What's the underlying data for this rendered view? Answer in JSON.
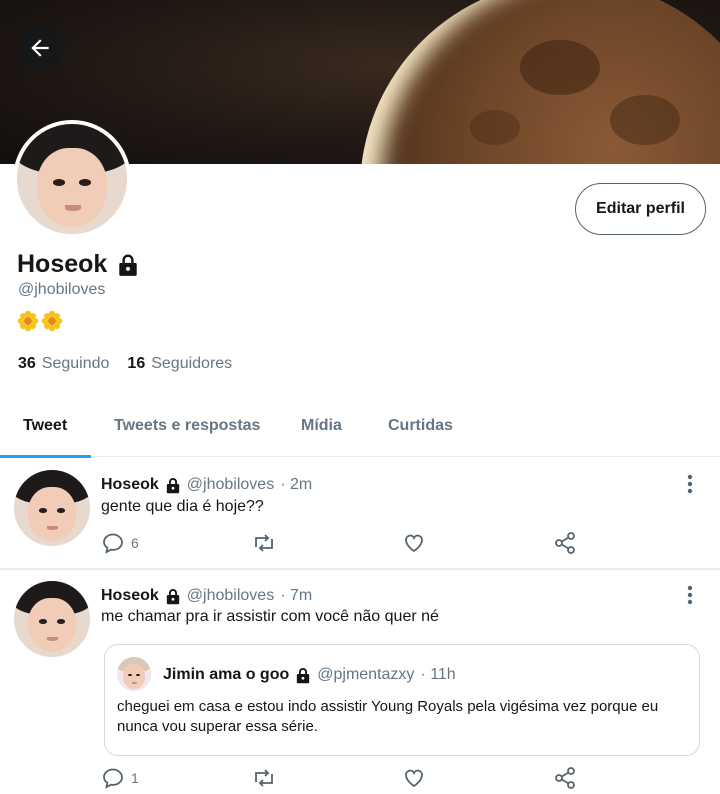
{
  "profile": {
    "display_name": "Hoseok",
    "handle": "@jhobiloves",
    "bio_emoji": [
      "sunflower-emoji",
      "sunflower-emoji"
    ],
    "following_count": "36",
    "following_label": "Seguindo",
    "followers_count": "16",
    "followers_label": "Seguidores",
    "edit_button": "Editar perfil"
  },
  "tabs": [
    {
      "label": "Tweet",
      "active": true
    },
    {
      "label": "Tweets e respostas",
      "active": false
    },
    {
      "label": "Mídia",
      "active": false
    },
    {
      "label": "Curtidas",
      "active": false
    }
  ],
  "tweets": [
    {
      "name": "Hoseok",
      "handle": "@jhobiloves",
      "time": "· 2m",
      "text": "gente que dia é hoje??",
      "reply_count": "6"
    },
    {
      "name": "Hoseok",
      "handle": "@jhobiloves",
      "time": "· 7m",
      "text": "me chamar pra ir assistir com você não quer né",
      "reply_count": "1",
      "quote": {
        "name": "Jimin ama o goo",
        "handle": "@pjmentazxy",
        "time": "· 11h",
        "text": "cheguei em casa e estou indo assistir Young Royals pela vigésima vez porque eu nunca vou superar essa série."
      }
    }
  ],
  "colors": {
    "accent": "#1da1f2",
    "text_primary": "#14171a",
    "text_secondary": "#657786"
  },
  "icons": [
    "back-arrow-icon",
    "lock-icon",
    "reply-icon",
    "retweet-icon",
    "like-icon",
    "share-icon",
    "more-vertical-icon"
  ]
}
